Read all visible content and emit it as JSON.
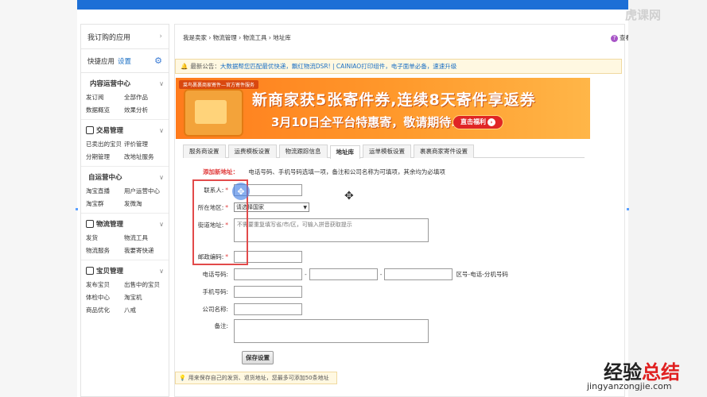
{
  "watermark": {
    "top": "虎课网",
    "bottom_black": "经验",
    "bottom_red": "总结",
    "url": "jingyanzongjie.com"
  },
  "sidebar": {
    "apps_title": "我订购的应用",
    "quick": {
      "label": "快捷应用",
      "settings": "设置"
    },
    "sections": [
      {
        "title": "内容运营中心",
        "items": [
          "发订阅",
          "全部作品",
          "数据概览",
          "效果分析"
        ]
      },
      {
        "title": "交易管理",
        "items": [
          "已卖出的宝贝",
          "评价管理",
          "分期管理",
          "改地址服务"
        ]
      },
      {
        "title": "自运营中心",
        "items": [
          "淘宝直播",
          "用户运营中心",
          "淘宝群",
          "发微淘"
        ]
      },
      {
        "title": "物流管理",
        "items": [
          "发货",
          "物流工具",
          "物流服务",
          "我要寄快递"
        ]
      },
      {
        "title": "宝贝管理",
        "items": [
          "发布宝贝",
          "出售中的宝贝",
          "体检中心",
          "淘宝机",
          "商品优化",
          "八戒"
        ]
      }
    ]
  },
  "breadcrumb": "我是卖家 › 物流管理 › 物流工具 › 地址库",
  "help": "查看帮助",
  "notice": {
    "prefix": "最新公告：",
    "text": "大数据帮您匹配最优快递，飘红物流DSR! | CAINIAO打印组件，电子面单必备，速速升级"
  },
  "banner": {
    "ribbon": "菜鸟裹裹商家寄件—官方寄件服务",
    "line1": "新商家获5张寄件券,连续8天寄件享返券",
    "line2": "3月10日全平台特惠寄，敬请期待...",
    "cta": "直击福利"
  },
  "tabs": [
    "服务商设置",
    "运费模板设置",
    "物流跟踪信息",
    "地址库",
    "运单模板设置",
    "裹裹商家寄件设置"
  ],
  "active_tab": 3,
  "form": {
    "title": "添加新地址：",
    "note": "电话号码、手机号码选填一项，备注和公司名称为可填项，其余均为必填项",
    "contact_label": "联系人:",
    "region_label": "所在地区:",
    "region_value": "请选择国家",
    "street_label": "街道地址:",
    "street_placeholder": "不需要重复填写省/市/区，可输入拼音获取提示",
    "postal_label": "邮政编码:",
    "phone_label": "电话号码:",
    "phone_hint": "区号-电话-分机号码",
    "mobile_label": "手机号码:",
    "company_label": "公司名称:",
    "remark_label": "备注:",
    "save": "保存设置",
    "star": "*"
  },
  "tip": "用来保存自己的发货、退货地址，您最多可添加50条地址"
}
